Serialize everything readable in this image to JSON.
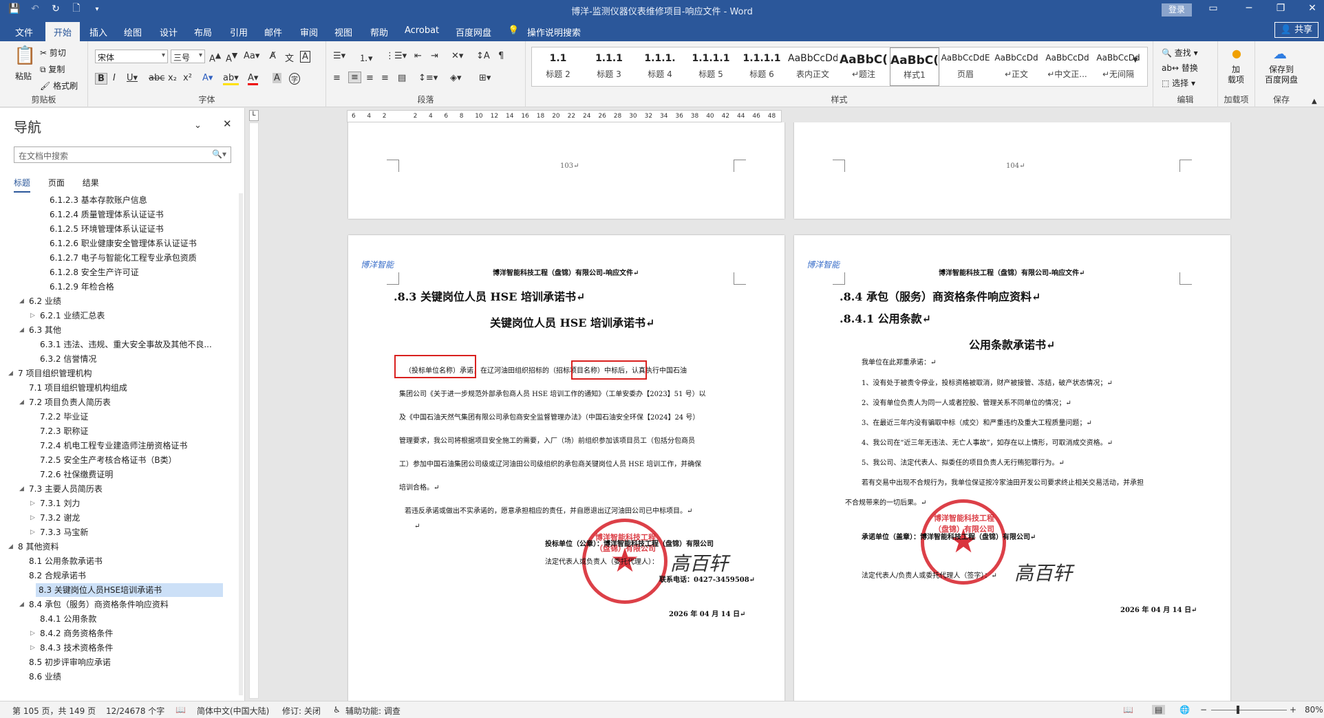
{
  "app": {
    "title": "博洋-监测仪器仪表维修项目-响应文件 - Word",
    "login": "登录",
    "share": "共享"
  },
  "menu": [
    "文件",
    "开始",
    "插入",
    "绘图",
    "设计",
    "布局",
    "引用",
    "邮件",
    "审阅",
    "视图",
    "帮助",
    "Acrobat",
    "百度网盘",
    "操作说明搜索"
  ],
  "ribbon": {
    "clipboard": {
      "paste": "粘贴",
      "cut": "剪切",
      "copy": "复制",
      "format_painter": "格式刷",
      "label": "剪贴板"
    },
    "font": {
      "name": "宋体",
      "size": "三号",
      "label": "字体"
    },
    "paragraph": {
      "label": "段落"
    },
    "styles": {
      "items": [
        {
          "preview": "1.1 ",
          "name": "标题 2"
        },
        {
          "preview": "1.1.1 ",
          "name": "标题 3"
        },
        {
          "preview": "1.1.1.",
          "name": "标题 4"
        },
        {
          "preview": "1.1.1.1",
          "name": "标题 5"
        },
        {
          "preview": "1.1.1.1",
          "name": "标题 6"
        },
        {
          "preview": "AaBbCcDdI",
          "name": "表内正文"
        },
        {
          "preview": "AaBbC(",
          "name": "↵题注"
        },
        {
          "preview": "AaBbC(",
          "name": "样式1"
        },
        {
          "preview": "AaBbCcDdE",
          "name": "页眉"
        },
        {
          "preview": "AaBbCcDd",
          "name": "↵正文"
        },
        {
          "preview": "AaBbCcDd",
          "name": "↵中文正..."
        },
        {
          "preview": "AaBbCcDd",
          "name": "↵无间隔"
        }
      ],
      "label": "样式"
    },
    "editing": {
      "find": "查找",
      "replace": "替换",
      "select": "选择",
      "label": "编辑"
    },
    "addin": {
      "load": "加\n载项",
      "label": "加载项"
    },
    "baidu": {
      "save": "保存到\n百度网盘",
      "label": "保存"
    }
  },
  "nav": {
    "title": "导航",
    "search_placeholder": "在文档中搜索",
    "tabs": [
      "标题",
      "页面",
      "结果"
    ],
    "items": [
      {
        "text": "6.1.2.3 基本存款账户信息",
        "level": 3
      },
      {
        "text": "6.1.2.4 质量管理体系认证证书",
        "level": 3
      },
      {
        "text": "6.1.2.5 环境管理体系认证证书",
        "level": 3
      },
      {
        "text": "6.1.2.6 职业健康安全管理体系认证证书",
        "level": 3
      },
      {
        "text": "6.1.2.7 电子与智能化工程专业承包资质",
        "level": 3
      },
      {
        "text": "6.1.2.8 安全生产许可证",
        "level": 3
      },
      {
        "text": "6.1.2.9 年检合格",
        "level": 3
      },
      {
        "text": "6.2 业绩",
        "level": 1,
        "arrow": "◢"
      },
      {
        "text": "6.2.1 业绩汇总表",
        "level": 2,
        "arrow": "▷"
      },
      {
        "text": "6.3 其他",
        "level": 1,
        "arrow": "◢"
      },
      {
        "text": "6.3.1 违法、违规、重大安全事故及其他不良...",
        "level": 2
      },
      {
        "text": "6.3.2 信誉情况",
        "level": 2
      },
      {
        "text": "7 项目组织管理机构",
        "level": 0,
        "arrow": "◢"
      },
      {
        "text": "7.1 项目组织管理机构组成",
        "level": 1
      },
      {
        "text": "7.2 项目负责人简历表",
        "level": 1,
        "arrow": "◢"
      },
      {
        "text": "7.2.2 毕业证",
        "level": 2
      },
      {
        "text": "7.2.3 职称证",
        "level": 2
      },
      {
        "text": "7.2.4 机电工程专业建造师注册资格证书",
        "level": 2
      },
      {
        "text": "7.2.5 安全生产考核合格证书（B类）",
        "level": 2
      },
      {
        "text": "7.2.6 社保缴费证明",
        "level": 2
      },
      {
        "text": "7.3 主要人员简历表",
        "level": 1,
        "arrow": "◢"
      },
      {
        "text": "7.3.1 刘力",
        "level": 2,
        "arrow": "▷"
      },
      {
        "text": "7.3.2 谢龙",
        "level": 2,
        "arrow": "▷"
      },
      {
        "text": "7.3.3 马宝新",
        "level": 2,
        "arrow": "▷"
      },
      {
        "text": "8 其他资料",
        "level": 0,
        "arrow": "◢"
      },
      {
        "text": "8.1 公用条款承诺书",
        "level": 1
      },
      {
        "text": "8.2 合规承诺书",
        "level": 1
      },
      {
        "text": "8.3 关键岗位人员HSE培训承诺书",
        "level": 1,
        "selected": true
      },
      {
        "text": "8.4 承包（服务）商资格条件响应资料",
        "level": 1,
        "arrow": "◢"
      },
      {
        "text": "8.4.1 公用条款",
        "level": 2
      },
      {
        "text": "8.4.2 商务资格条件",
        "level": 2,
        "arrow": "▷"
      },
      {
        "text": "8.4.3 技术资格条件",
        "level": 2,
        "arrow": "▷"
      },
      {
        "text": "8.5 初步评审响应承诺",
        "level": 1
      },
      {
        "text": "8.6 业绩",
        "level": 1
      }
    ]
  },
  "ruler_ticks": [
    "6",
    "4",
    "2",
    "",
    "2",
    "4",
    "6",
    "8",
    "10",
    "12",
    "14",
    "16",
    "18",
    "20",
    "22",
    "24",
    "26",
    "28",
    "30",
    "32",
    "34",
    "36",
    "38",
    "40",
    "42",
    "44",
    "46",
    "48"
  ],
  "pages": {
    "p103": {
      "number": "103↵"
    },
    "p104": {
      "number": "104↵"
    },
    "left": {
      "header": "博洋智能科技工程（盘锦）有限公司-响应文件↵",
      "logo": "博洋智能",
      "heading": ".8.3    关键岗位人员 HSE 培训承诺书↵",
      "title": "关键岗位人员 HSE 培训承诺书↵",
      "red_label_1": "（投标单位名称）",
      "red_label_2": "（招标项目名称）",
      "lines": [
        "        （投标单位名称）承诺，在辽河油田组织招标的（招标项目名称）中标后，认真执行中国石油",
        "集团公司《关于进一步规范外部承包商人员 HSE 培训工作的通知》（工单安委办【2023】51 号）以",
        "及《中国石油天然气集团有限公司承包商安全监督管理办法》（中国石油安全环保【2024】24 号）",
        "管理要求，我公司将根据项目安全施工的需要，入厂（场）前组织参加该项目员工（包括分包商员",
        "工）参加中国石油集团公司级或辽河油田公司级组织的承包商关键岗位人员 HSE 培训工作，并确保",
        "培训合格。↵",
        "        若违反承诺或做出不实承诺的，愿意承担相应的责任，并自愿退出辽河油田公司已中标项目。↵",
        "↵"
      ],
      "sign_unit": "投标单位（公章）：博洋智能科技工程（盘锦）有限公司",
      "sign_rep": "法定代表人或负责人（委托代理人）：",
      "phone": "联系电话：0427-3459508↵",
      "date": "2026 年 04 月 14 日↵",
      "seal_text": "博洋智能科技工程（盘锦）有限公司"
    },
    "right": {
      "header": "博洋智能科技工程（盘锦）有限公司-响应文件↵",
      "logo": "博洋智能",
      "heading": ".8.4    承包（服务）商资格条件响应资料↵",
      "subheading": ".8.4.1 公用条款↵",
      "title": "公用条款承诺书↵",
      "lines": [
        "我单位在此郑重承诺：↵",
        "1、没有处于被责令停业，投标资格被取消，财产被接管、冻结，破产状态情况；↵",
        "2、没有单位负责人为同一人或者控股、管理关系不同单位的情况；↵",
        "3、在最近三年内没有骗取中标（成交）和严重违约及重大工程质量问题；↵",
        "4、我公司在“近三年无违法、无亡人事故”，如存在以上情形，可取消成交资格。↵",
        "5、我公司、法定代表人、拟委任的项目负责人无行贿犯罪行为。↵",
        "若有交易中出现不合规行为，我单位保证按冷家油田开发公司要求终止相关交易活动，并承担",
        "不合规带来的一切后果。↵"
      ],
      "sign_unit": "承诺单位（盖章）：博洋智能科技工程（盘锦）有限公司↵",
      "sign_rep": "法定代表人/负责人或委托代理人（签字）：↵",
      "date": "2026 年 04 月 14 日↵",
      "seal_text": "博洋智能科技工程（盘锦）有限公司"
    }
  },
  "signature": "高百轩",
  "status": {
    "page": "第 105 页，共 149 页",
    "words": "12/24678 个字",
    "lang": "简体中文(中国大陆)",
    "track": "修订: 关闭",
    "access": "辅助功能: 调查",
    "zoom": "80%"
  }
}
